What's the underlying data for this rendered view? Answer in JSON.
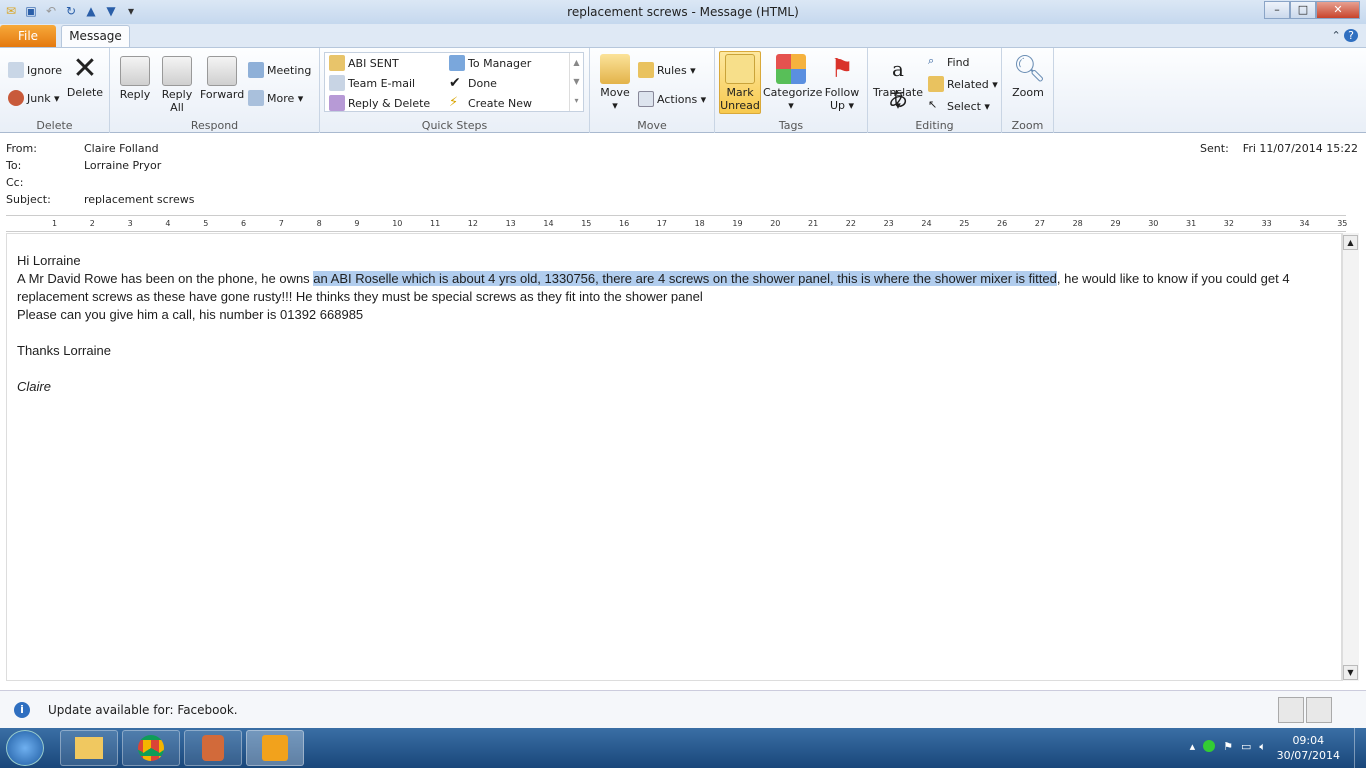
{
  "window": {
    "title": "replacement screws  -  Message (HTML)",
    "minimize": "–",
    "maximize": "□",
    "close": "✕"
  },
  "tabs": {
    "file": "File",
    "message": "Message"
  },
  "ribbon": {
    "delete_group": {
      "label": "Delete",
      "ignore": "Ignore",
      "junk": "Junk ▾",
      "delete": "Delete"
    },
    "respond_group": {
      "label": "Respond",
      "reply": "Reply",
      "reply_all_1": "Reply",
      "reply_all_2": "All",
      "forward": "Forward",
      "meeting": "Meeting",
      "more": "More ▾"
    },
    "quick_steps": {
      "label": "Quick Steps",
      "items": [
        "ABI SENT",
        "To Manager",
        "Team E-mail",
        "Done",
        "Reply & Delete",
        "Create New"
      ]
    },
    "move_group": {
      "label": "Move",
      "move": "Move",
      "rules": "Rules ▾",
      "actions": "Actions ▾"
    },
    "tags_group": {
      "label": "Tags",
      "mark_1": "Mark",
      "mark_2": "Unread",
      "categorize": "Categorize",
      "follow_1": "Follow",
      "follow_2": "Up ▾"
    },
    "editing_group": {
      "label": "Editing",
      "translate": "Translate",
      "find": "Find",
      "related": "Related ▾",
      "select": "Select ▾"
    },
    "zoom_group": {
      "label": "Zoom",
      "zoom": "Zoom"
    }
  },
  "header": {
    "from_label": "From:",
    "from": "Claire Folland",
    "to_label": "To:",
    "to": "Lorraine Pryor",
    "cc_label": "Cc:",
    "subject_label": "Subject:",
    "subject": "replacement screws",
    "sent_label": "Sent:",
    "sent": "Fri 11/07/2014 15:22"
  },
  "ruler": [
    "1",
    "2",
    "3",
    "4",
    "5",
    "6",
    "7",
    "8",
    "9",
    "10",
    "11",
    "12",
    "13",
    "14",
    "15",
    "16",
    "17",
    "18",
    "19",
    "20",
    "21",
    "22",
    "23",
    "24",
    "25",
    "26",
    "27",
    "28",
    "29",
    "30",
    "31",
    "32",
    "33",
    "34",
    "35"
  ],
  "body": {
    "greeting": "Hi Lorraine",
    "p1_a": "A Mr David Rowe has been on the phone, he owns ",
    "p1_sel": "an ABI Roselle which is about 4 yrs old, 1330756, there are 4 screws on the shower panel, this is where the shower mixer is fitted",
    "p1_b": ", he would like to know if you could get 4 replacement screws as these have gone rusty!!! He thinks they must be special screws as they fit into the shower panel",
    "p2": "Please can you give him a call, his number is 01392 668985",
    "thanks": "Thanks Lorraine",
    "signature": "Claire"
  },
  "infobar": {
    "text": "Update available for: Facebook."
  },
  "taskbar": {
    "time": "09:04",
    "date": "30/07/2014"
  }
}
